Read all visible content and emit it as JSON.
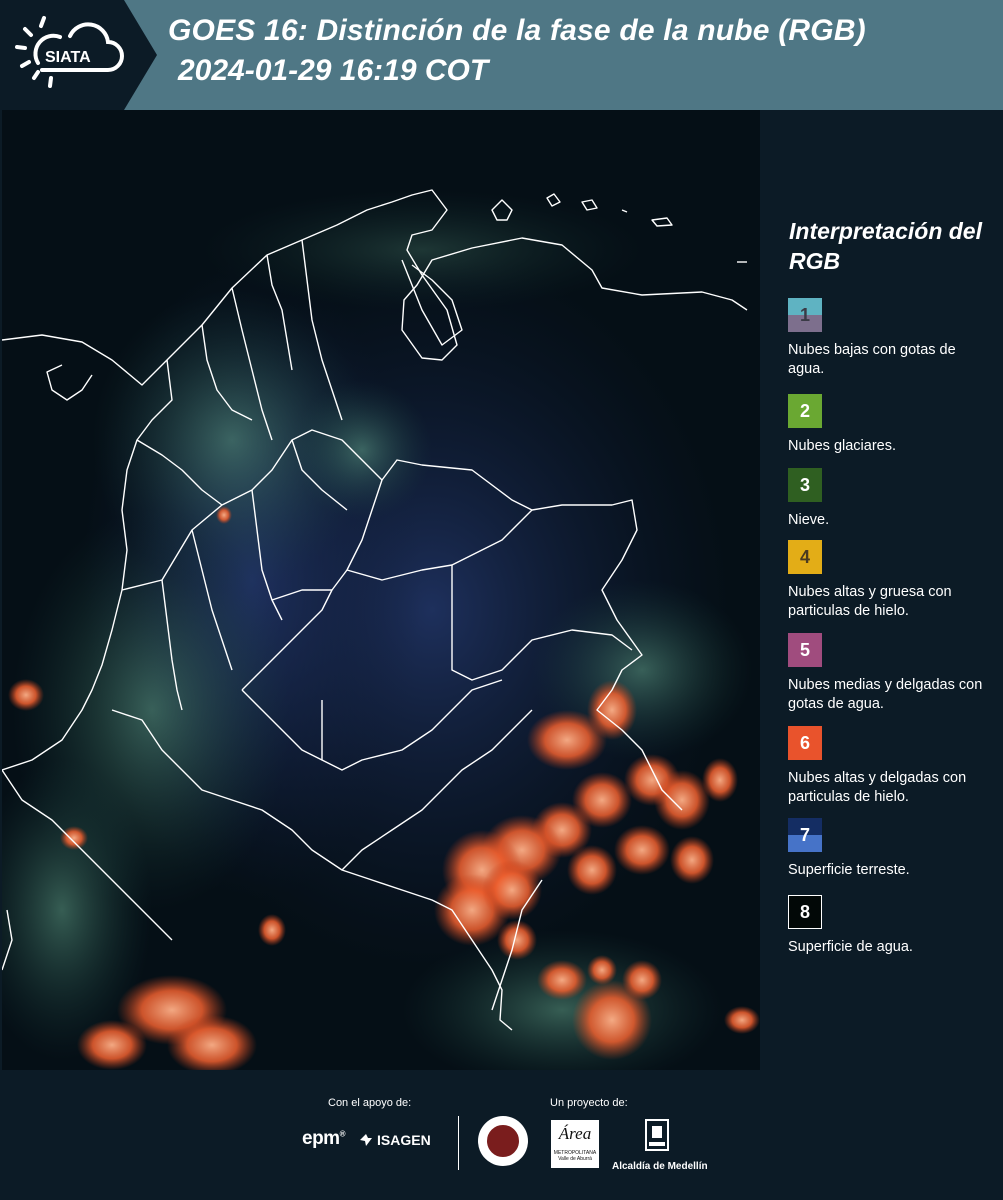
{
  "header": {
    "logo_text": "SIATA",
    "title_line1": "GOES 16: Distinción de la fase de la nube (RGB)",
    "title_line2": "2024-01-29 16:19 COT"
  },
  "legend": {
    "title": "Interpretación del RGB",
    "items": [
      {
        "number": "1",
        "top_color": "#5fb3c2",
        "bottom_color": "#7d6f8d",
        "num_color": "#3a3a46",
        "description": "Nubes bajas con gotas de agua."
      },
      {
        "number": "2",
        "top_color": "#6aa832",
        "bottom_color": "#6aa832",
        "num_color": "#ffffff",
        "description": "Nubes glaciares."
      },
      {
        "number": "3",
        "top_color": "#2f5f21",
        "bottom_color": "#2f5f21",
        "num_color": "#ffffff",
        "description": "Nieve."
      },
      {
        "number": "4",
        "top_color": "#e3ad17",
        "bottom_color": "#e3ad17",
        "num_color": "#4a3a20",
        "description": "Nubes altas y gruesa con particulas de hielo."
      },
      {
        "number": "5",
        "top_color": "#a04c7e",
        "bottom_color": "#a04c7e",
        "num_color": "#ffffff",
        "description": "Nubes medias y delgadas con gotas de agua."
      },
      {
        "number": "6",
        "top_color": "#e9532c",
        "bottom_color": "#e9532c",
        "num_color": "#ffffff",
        "description": "Nubes altas y delgadas con particulas de hielo."
      },
      {
        "number": "7",
        "top_color": "#142d63",
        "bottom_color": "#4673c8",
        "num_color": "#ffffff",
        "description": "Superficie terreste."
      },
      {
        "number": "8",
        "top_color": "#020807",
        "bottom_color": "#020807",
        "num_color": "#ffffff",
        "description": "Superficie de agua."
      }
    ]
  },
  "footer": {
    "support_label": "Con el apoyo de:",
    "project_label": "Un proyecto de:",
    "epm_logo_text": "epm",
    "isagen_logo_text": "ISAGEN",
    "metro_logo_text": "Área",
    "metro_logo_sub": "METROPOLITANA",
    "metro_logo_sub2": "Valle de Aburrá",
    "alcaldia_logo_text": "Alcaldía de Medellín"
  }
}
